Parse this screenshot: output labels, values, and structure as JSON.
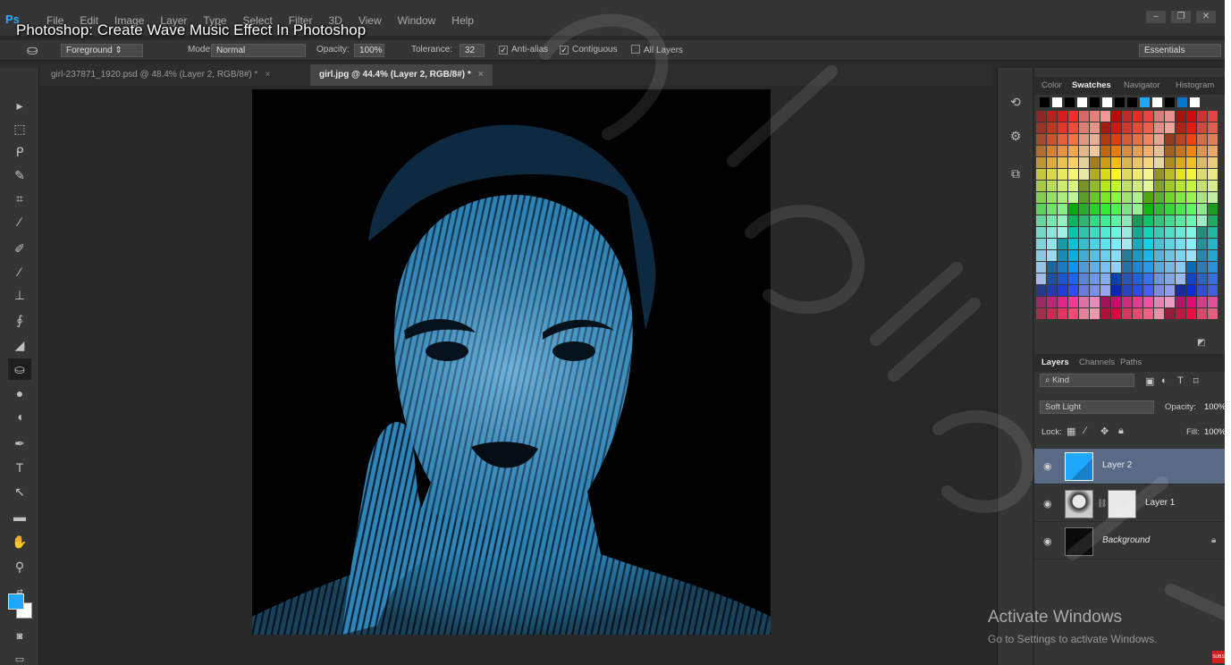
{
  "video_title": "Photoshop: Create Wave Music Effect In Photoshop",
  "menu": {
    "logo": "Ps",
    "items": [
      "File",
      "Edit",
      "Image",
      "Layer",
      "Type",
      "Select",
      "Filter",
      "3D",
      "View",
      "Window",
      "Help"
    ]
  },
  "options_bar": {
    "fill_source": "Foreground",
    "mode_label": "Mode:",
    "mode_value": "Normal",
    "opacity_label": "Opacity:",
    "opacity_value": "100%",
    "tolerance_label": "Tolerance:",
    "tolerance_value": "32",
    "antialias_label": "Anti-alias",
    "contiguous_label": "Contiguous",
    "all_layers_label": "All Layers",
    "workspace": "Essentials"
  },
  "tabs": [
    {
      "label": "girl-237871_1920.psd @ 48.4% (Layer 2, RGB/8#) *",
      "close": "×",
      "active": false
    },
    {
      "label": "girl.jpg @ 44.4% (Layer 2, RGB/8#) *",
      "close": "×",
      "active": true
    }
  ],
  "tools": [
    "move-tool",
    "marquee-tool",
    "lasso-tool",
    "quick-select-tool",
    "crop-tool",
    "eyedropper-tool",
    "healing-brush-tool",
    "brush-tool",
    "clone-stamp-tool",
    "history-brush-tool",
    "eraser-tool",
    "paint-bucket-tool",
    "blur-tool",
    "dodge-tool",
    "pen-tool",
    "type-tool",
    "path-selection-tool",
    "rectangle-tool",
    "hand-tool",
    "zoom-tool"
  ],
  "colors": {
    "foreground": "#1ea7fd",
    "background": "#ffffff",
    "selected_layer": "#596a87",
    "app_bg": "#282828",
    "panel_bg": "#353535"
  },
  "swatches_panel": {
    "tabs": [
      "Color",
      "Swatches",
      "Navigator",
      "Histogram"
    ],
    "active_tab": "Swatches"
  },
  "layers_panel": {
    "tabs": [
      "Layers",
      "Channels",
      "Paths"
    ],
    "active_tab": "Layers",
    "filter_kind": "Kind",
    "blend_mode": "Soft Light",
    "opacity_label": "Opacity:",
    "opacity_value": "100%",
    "lock_label": "Lock:",
    "fill_label": "Fill:",
    "fill_value": "100%",
    "layers": [
      {
        "name": "Layer 2",
        "selected": true
      },
      {
        "name": "Layer 1",
        "selected": false
      },
      {
        "name": "Background",
        "selected": false,
        "locked": true
      }
    ]
  },
  "windows_watermark": {
    "title": "Activate Windows",
    "subtitle": "Go to Settings to activate Windows."
  },
  "subscribe_badge": "SUBS"
}
